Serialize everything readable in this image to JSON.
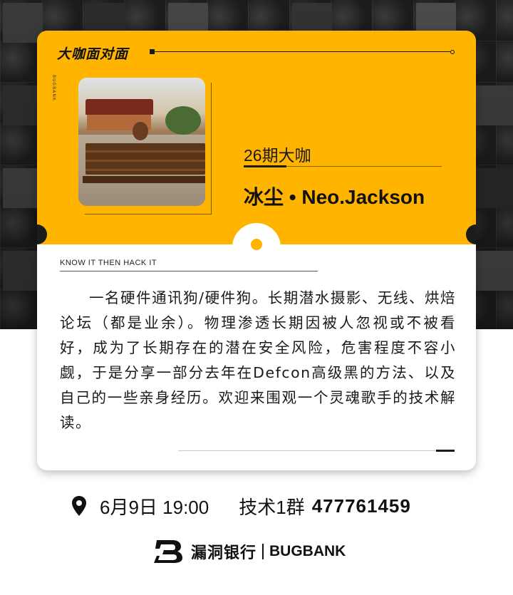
{
  "header": {
    "brand_title": "大咖面对面",
    "vertical_caption": "BUGBANK"
  },
  "guest": {
    "issue": "26期大咖",
    "name": "冰尘 • Neo.Jackson",
    "photo_icon": "bench-photo"
  },
  "card": {
    "slogan": "KNOW  IT THEN  HACK  IT",
    "bio": "一名硬件通讯狗/硬件狗。长期潜水摄影、无线、烘焙论坛（都是业余）。物理渗透长期因被人忽视或不被看好，成为了长期存在的潜在安全风险，危害程度不容小觑，于是分享一部分去年在Defcon高级黑的方法、以及自己的一些亲身经历。欢迎来围观一个灵魂歌手的技术解读。"
  },
  "event": {
    "location_icon": "map-pin-icon",
    "date_time": "6月9日 19:00",
    "group_label": "技术1群",
    "group_number": "477761459"
  },
  "footer": {
    "logo_icon": "bugbank-b-icon",
    "name_cn": "漏洞银行",
    "name_en": "BUGBANK"
  },
  "colors": {
    "accent": "#ffb400",
    "dark": "#1c1c1c",
    "text": "#111111"
  }
}
